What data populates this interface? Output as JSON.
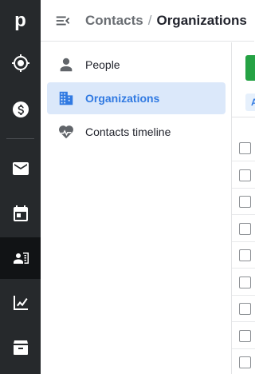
{
  "rail": {
    "logo": "p",
    "items": [
      {
        "icon": "target-icon",
        "name": "leads"
      },
      {
        "icon": "dollar-icon",
        "name": "deals"
      },
      {
        "icon": "mail-icon",
        "name": "mail"
      },
      {
        "icon": "calendar-icon",
        "name": "activities"
      },
      {
        "icon": "contacts-icon",
        "name": "contacts"
      },
      {
        "icon": "chart-icon",
        "name": "insights"
      },
      {
        "icon": "box-icon",
        "name": "products"
      }
    ]
  },
  "header": {
    "section": "Contacts",
    "separator": "/",
    "current": "Organizations"
  },
  "subnav": {
    "items": [
      {
        "label": "People",
        "icon": "person-icon"
      },
      {
        "label": "Organizations",
        "icon": "building-icon",
        "active": true
      },
      {
        "label": "Contacts timeline",
        "icon": "heartbeat-icon"
      }
    ]
  },
  "pane": {
    "filter_chip_text": "A",
    "row_count": 9
  },
  "colors": {
    "rail_bg": "#26292c",
    "active_blue": "#317ae2",
    "active_bg": "#dbe8fa",
    "add_green": "#25a244"
  }
}
